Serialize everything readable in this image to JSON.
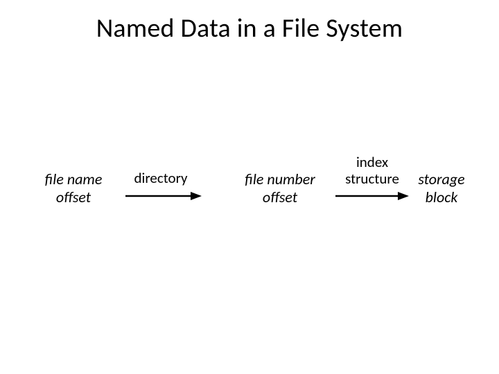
{
  "title": "Named Data in a File System",
  "diagram": {
    "nodes": {
      "n1": {
        "line1": "file name",
        "line2": "offset"
      },
      "n2": {
        "line1": "file number",
        "line2": "offset"
      },
      "n3": {
        "line1": "storage",
        "line2": "block"
      }
    },
    "arrows": {
      "a1": {
        "label_line1": "directory",
        "label_line2": ""
      },
      "a2": {
        "label_line1": "index",
        "label_line2": "structure"
      }
    }
  }
}
